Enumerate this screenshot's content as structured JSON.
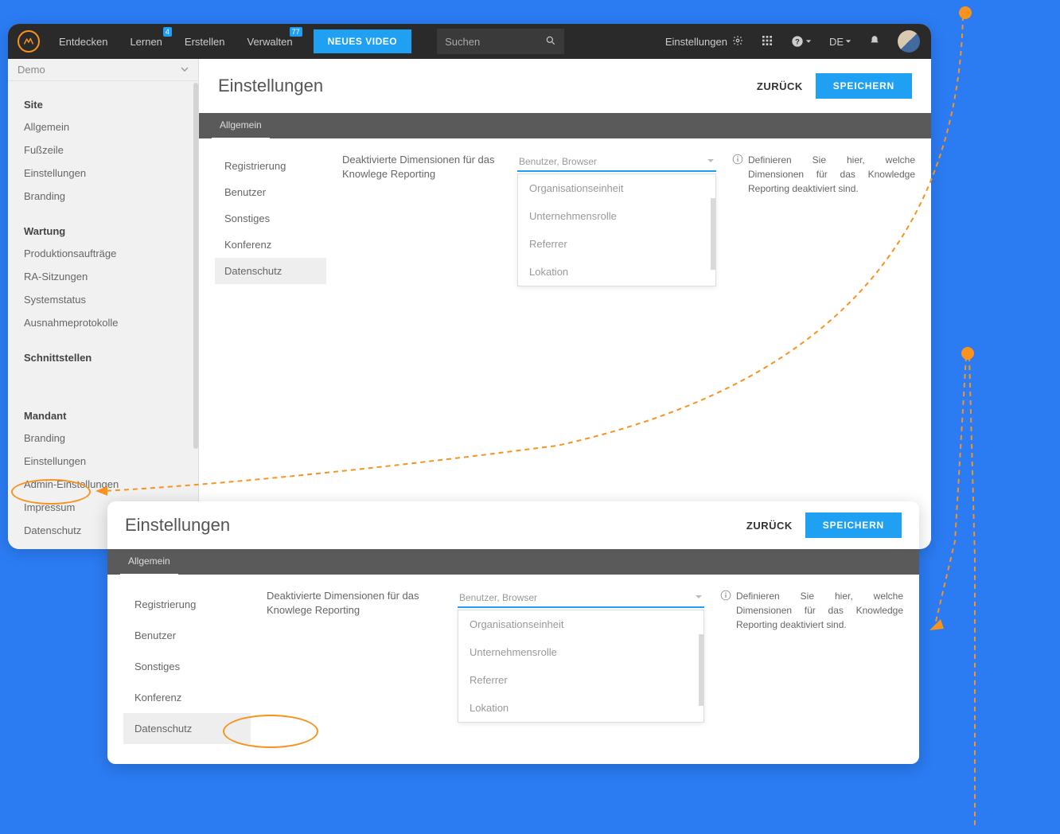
{
  "top": {
    "nav": [
      {
        "label": "Entdecken"
      },
      {
        "label": "Lernen",
        "badge": "4"
      },
      {
        "label": "Erstellen"
      },
      {
        "label": "Verwalten",
        "badge": "77"
      }
    ],
    "new_video": "NEUES VIDEO",
    "search_placeholder": "Suchen",
    "settings_label": "Einstellungen",
    "lang": "DE"
  },
  "sidebar": {
    "selector": "Demo",
    "groups": [
      {
        "title": "Site",
        "items": [
          "Allgemein",
          "Fußzeile",
          "Einstellungen",
          "Branding"
        ]
      },
      {
        "title": "Wartung",
        "items": [
          "Produktionsaufträge",
          "RA-Sitzungen",
          "Systemstatus",
          "Ausnahmeprotokolle"
        ]
      },
      {
        "title": "Schnittstellen",
        "items": []
      },
      {
        "title": "Mandant",
        "items": [
          "Branding",
          "Einstellungen",
          "Admin-Einstellungen",
          "Impressum",
          "Datenschutz"
        ]
      }
    ]
  },
  "page": {
    "title": "Einstellungen",
    "back": "ZURÜCK",
    "save": "SPEICHERN",
    "tab": "Allgemein",
    "subnav": [
      "Registrierung",
      "Benutzer",
      "Sonstiges",
      "Konferenz",
      "Datenschutz"
    ],
    "subnav_active": 4,
    "field_label": "Deaktivierte Dimensionen für das Knowlege Reporting",
    "field_value": "Benutzer, Browser",
    "options": [
      "Organisationseinheit",
      "Unternehmensrolle",
      "Referrer",
      "Lokation"
    ],
    "help": "Definieren Sie hier, welche Dimensionen für das Knowledge Reporting deaktiviert sind."
  }
}
